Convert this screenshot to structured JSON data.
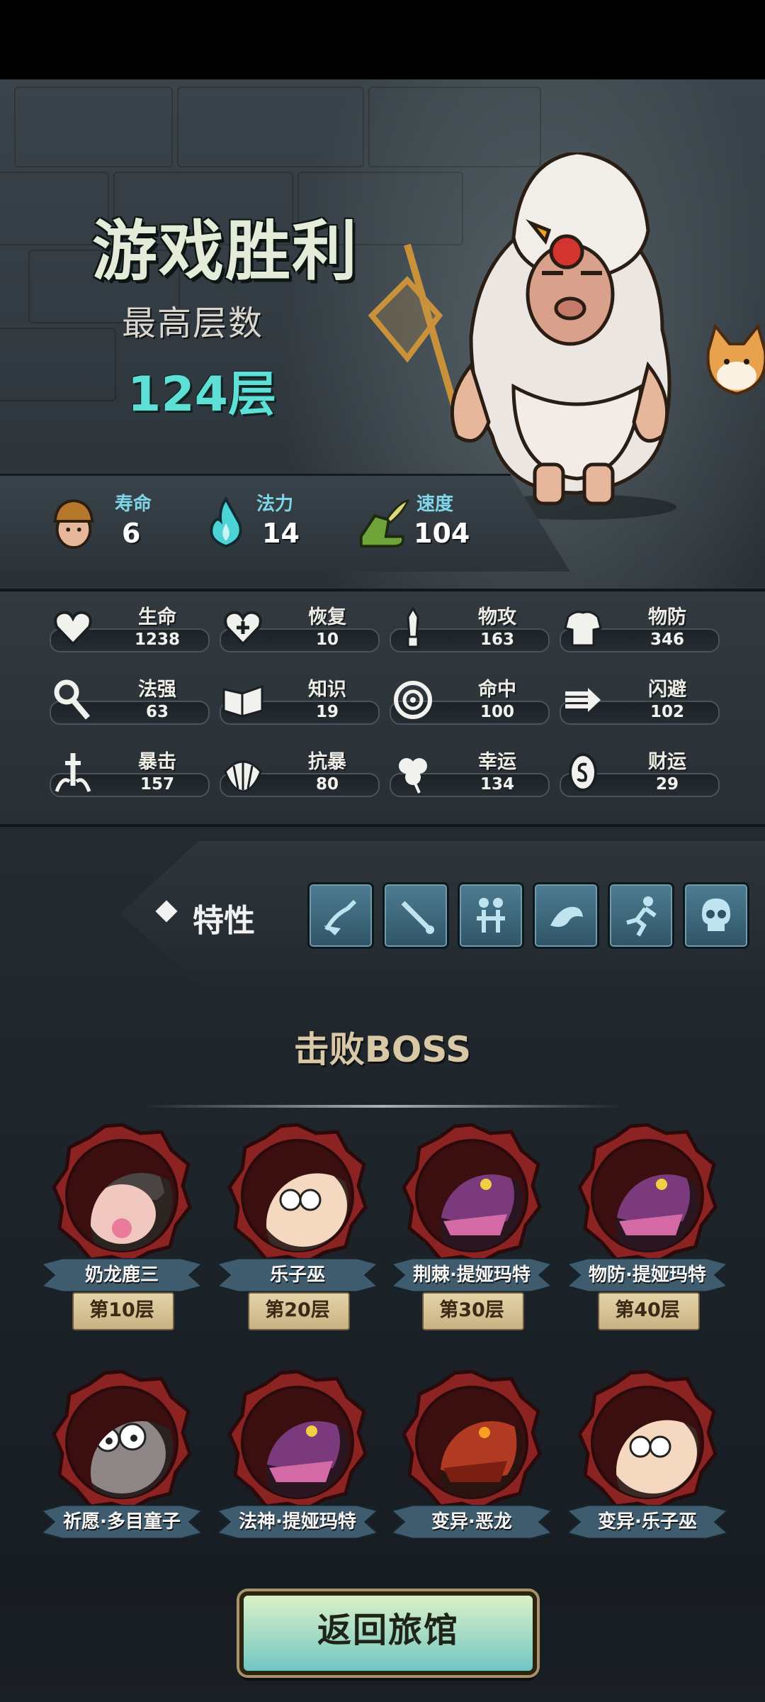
{
  "header": {
    "title": "游戏胜利",
    "subtitle": "最高层数",
    "max_floor": "124层"
  },
  "summary": {
    "items": [
      {
        "label": "寿命",
        "value": "6",
        "icon": "hero-head-icon"
      },
      {
        "label": "法力",
        "value": "14",
        "icon": "blue-flame-icon"
      },
      {
        "label": "速度",
        "value": "104",
        "icon": "winged-boot-icon"
      }
    ]
  },
  "stats": [
    {
      "label": "生命",
      "value": "1238",
      "icon": "heart-icon"
    },
    {
      "label": "恢复",
      "value": "10",
      "icon": "heart-plus-icon"
    },
    {
      "label": "物攻",
      "value": "163",
      "icon": "sword-icon"
    },
    {
      "label": "物防",
      "value": "346",
      "icon": "armor-icon"
    },
    {
      "label": "法强",
      "value": "63",
      "icon": "staff-icon"
    },
    {
      "label": "知识",
      "value": "19",
      "icon": "book-icon"
    },
    {
      "label": "命中",
      "value": "100",
      "icon": "target-icon"
    },
    {
      "label": "闪避",
      "value": "102",
      "icon": "dash-arrow-icon"
    },
    {
      "label": "暴击",
      "value": "157",
      "icon": "crit-sword-icon"
    },
    {
      "label": "抗暴",
      "value": "80",
      "icon": "shell-shield-icon"
    },
    {
      "label": "幸运",
      "value": "134",
      "icon": "clover-icon"
    },
    {
      "label": "财运",
      "value": "29",
      "icon": "coin-icon"
    }
  ],
  "traits": {
    "label": "特性",
    "items": [
      "broom-trait-icon",
      "sword-trait-icon",
      "twins-trait-icon",
      "arm-trait-icon",
      "runner-trait-icon",
      "skull-trait-icon"
    ]
  },
  "boss_section": {
    "title": "击败BOSS",
    "bosses": [
      {
        "name": "奶龙鹿三",
        "floor": "第10层",
        "portrait": "baby-helmet"
      },
      {
        "name": "乐子巫",
        "floor": "第20层",
        "portrait": "curly-lady"
      },
      {
        "name": "荆棘·提娅玛特",
        "floor": "第30层",
        "portrait": "purple-dragon"
      },
      {
        "name": "物防·提娅玛特",
        "floor": "第40层",
        "portrait": "purple-dragon"
      },
      {
        "name": "祈愿·多目童子",
        "floor": "",
        "portrait": "many-eyes"
      },
      {
        "name": "法神·提娅玛特",
        "floor": "",
        "portrait": "purple-dragon"
      },
      {
        "name": "变异·恶龙",
        "floor": "",
        "portrait": "red-dragon"
      },
      {
        "name": "变异·乐子巫",
        "floor": "",
        "portrait": "curly-lady"
      }
    ]
  },
  "back_button": {
    "label": "返回旅馆"
  },
  "colors": {
    "accent_cyan": "#5ee0d6",
    "title_text": "#e4ecd9",
    "button_top": "#d9f0c6",
    "button_bottom": "#6fc6c2",
    "boss_frame": "#8c2323"
  }
}
